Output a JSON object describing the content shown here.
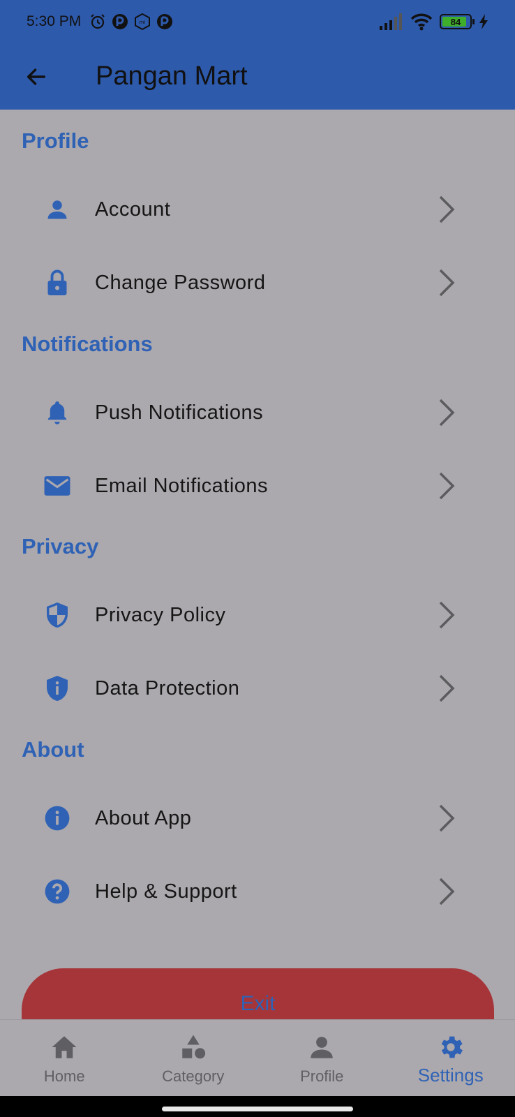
{
  "status_bar": {
    "time": "5:30 PM",
    "battery_level": "84",
    "icons": [
      "alarm-icon",
      "app-notification-icon",
      "mi-icon",
      "app-notification-icon",
      "signal-icon",
      "wifi-icon",
      "battery-icon",
      "charging-icon"
    ]
  },
  "app_bar": {
    "title": "Pangan Mart",
    "back_icon": "arrow-left-icon"
  },
  "sections": [
    {
      "title": "Profile",
      "items": [
        {
          "label": "Account",
          "icon": "person-icon"
        },
        {
          "label": "Change Password",
          "icon": "lock-icon"
        }
      ]
    },
    {
      "title": "Notifications",
      "items": [
        {
          "label": "Push Notifications",
          "icon": "bell-icon"
        },
        {
          "label": "Email Notifications",
          "icon": "mail-icon"
        }
      ]
    },
    {
      "title": "Privacy",
      "items": [
        {
          "label": "Privacy Policy",
          "icon": "shield-icon"
        },
        {
          "label": "Data Protection",
          "icon": "shield-info-icon"
        }
      ]
    },
    {
      "title": "About",
      "items": [
        {
          "label": "About App",
          "icon": "info-icon"
        },
        {
          "label": "Help & Support",
          "icon": "help-icon"
        }
      ]
    }
  ],
  "exit_button": {
    "label": "Exit"
  },
  "bottom_nav": {
    "items": [
      {
        "label": "Home",
        "icon": "home-icon"
      },
      {
        "label": "Category",
        "icon": "category-icon"
      },
      {
        "label": "Profile",
        "icon": "person-icon"
      },
      {
        "label": "Settings",
        "icon": "gear-icon"
      }
    ],
    "active": "Settings"
  },
  "colors": {
    "primary": "#2e5aac",
    "accent": "#2f62b5",
    "background": "#aca9ae",
    "exit": "#a53538"
  }
}
